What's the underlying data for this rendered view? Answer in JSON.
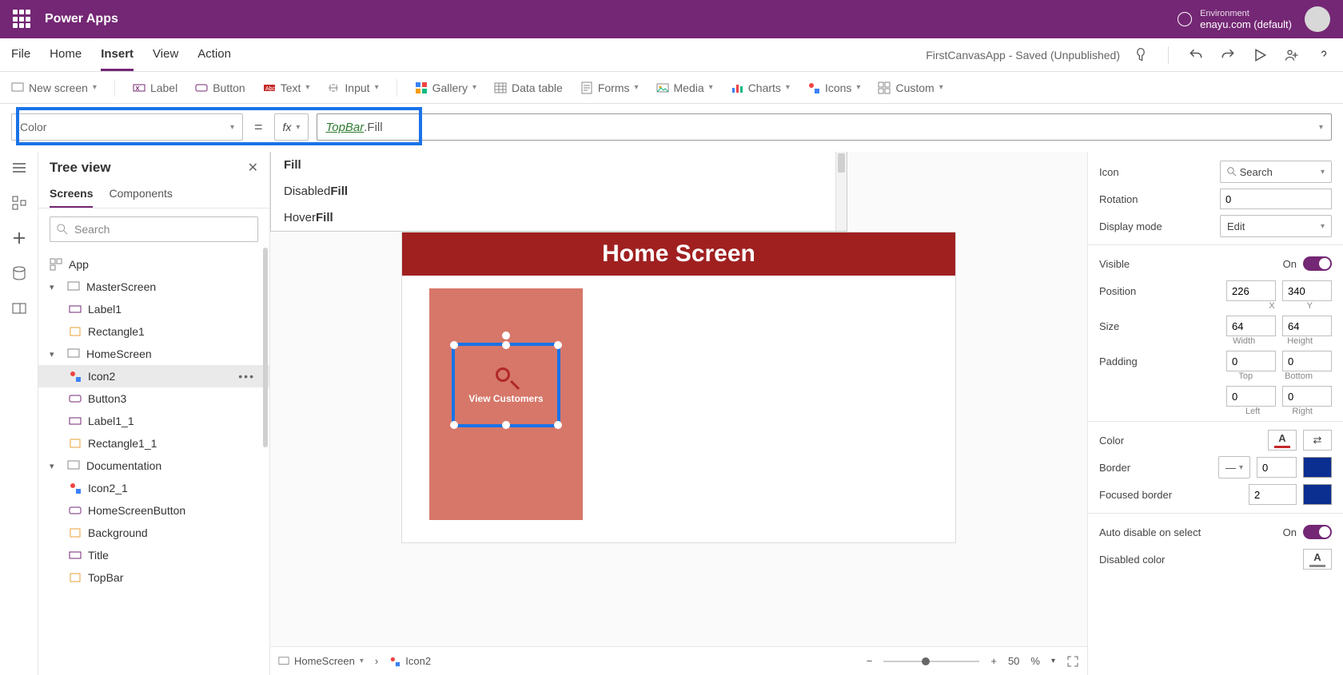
{
  "titlebar": {
    "appname": "Power Apps",
    "env_label": "Environment",
    "env_name": "enayu.com (default)"
  },
  "menubar": {
    "items": [
      "File",
      "Home",
      "Insert",
      "View",
      "Action"
    ],
    "active": "Insert",
    "document_status": "FirstCanvasApp - Saved (Unpublished)"
  },
  "ribbon": {
    "items": [
      "New screen",
      "Label",
      "Button",
      "Text",
      "Input",
      "Gallery",
      "Data table",
      "Forms",
      "Media",
      "Charts",
      "Icons",
      "Custom"
    ]
  },
  "formula": {
    "property": "Color",
    "fx": "fx",
    "reference": "TopBar",
    "member": ".Fill"
  },
  "autocomplete": {
    "items": [
      {
        "pre": "",
        "bold": "Fill"
      },
      {
        "pre": "Disabled",
        "bold": "Fill"
      },
      {
        "pre": "Hover",
        "bold": "Fill"
      }
    ]
  },
  "tree": {
    "title": "Tree view",
    "tabs": [
      "Screens",
      "Components"
    ],
    "active_tab": "Screens",
    "search_placeholder": "Search",
    "app_label": "App",
    "nodes": {
      "master": {
        "label": "MasterScreen",
        "children": [
          "Label1",
          "Rectangle1"
        ]
      },
      "home": {
        "label": "HomeScreen",
        "children": [
          "Icon2",
          "Button3",
          "Label1_1",
          "Rectangle1_1"
        ],
        "selected": "Icon2"
      },
      "doc": {
        "label": "Documentation",
        "children": [
          "Icon2_1",
          "HomeScreenButton",
          "Background",
          "Title",
          "TopBar"
        ]
      }
    }
  },
  "canvas": {
    "screen_title": "Home Screen",
    "card_button_label": "View Customers"
  },
  "breadcrumb": {
    "screen": "HomeScreen",
    "control": "Icon2",
    "zoom": "50",
    "zoom_pct": "%"
  },
  "properties": {
    "icon_label": "Icon",
    "icon_value": "Search",
    "rotation_label": "Rotation",
    "rotation_value": "0",
    "display_mode_label": "Display mode",
    "display_mode_value": "Edit",
    "visible_label": "Visible",
    "visible_value": "On",
    "position_label": "Position",
    "position_x": "226",
    "position_y": "340",
    "position_xl": "X",
    "position_yl": "Y",
    "size_label": "Size",
    "size_w": "64",
    "size_h": "64",
    "size_wl": "Width",
    "size_hl": "Height",
    "padding_label": "Padding",
    "padding_t": "0",
    "padding_b": "0",
    "padding_l": "0",
    "padding_r": "0",
    "padding_tl": "Top",
    "padding_bl": "Bottom",
    "padding_ll": "Left",
    "padding_rl": "Right",
    "color_label": "Color",
    "color_a": "A",
    "border_label": "Border",
    "border_value": "0",
    "focused_border_label": "Focused border",
    "focused_border_value": "2",
    "auto_disable_label": "Auto disable on select",
    "auto_disable_value": "On",
    "disabled_color_label": "Disabled color",
    "disabled_color_a": "A"
  }
}
